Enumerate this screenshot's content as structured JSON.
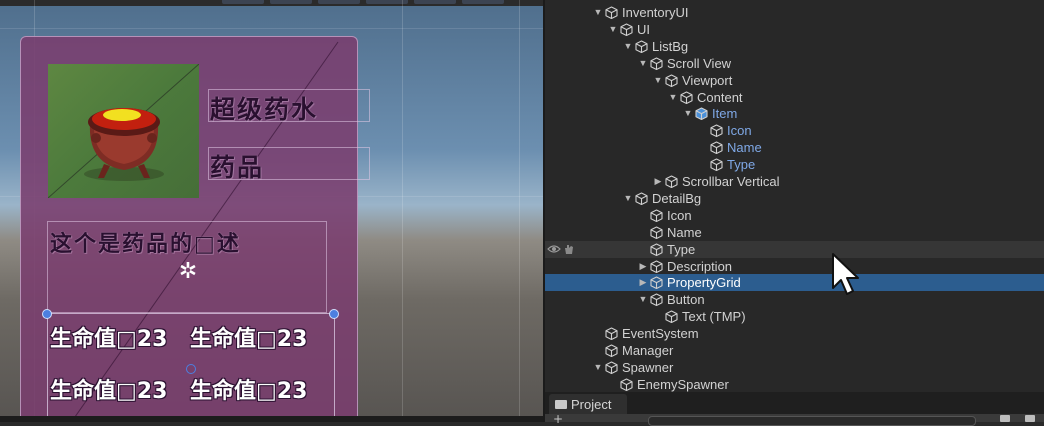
{
  "scene": {
    "detail_panel": {
      "name_text": "超级药水",
      "type_text": "药品",
      "description_text": "这个是药品的□述",
      "properties": [
        "生命值□23",
        "生命值□23",
        "生命值□23",
        "生命值□23"
      ]
    },
    "colors": {
      "panel": "#7a3e6e",
      "icon_bg": "#5a8441",
      "potion": "#f2e020"
    }
  },
  "hierarchy": {
    "rows": [
      {
        "label": "InventoryUI",
        "expanded": true
      },
      {
        "label": "UI",
        "expanded": true
      },
      {
        "label": "ListBg",
        "expanded": true
      },
      {
        "label": "Scroll View",
        "expanded": true
      },
      {
        "label": "Viewport",
        "expanded": true
      },
      {
        "label": "Content",
        "expanded": true
      },
      {
        "label": "Item",
        "expanded": true,
        "prefab": true
      },
      {
        "label": "Icon",
        "prefab": true
      },
      {
        "label": "Name",
        "prefab": true
      },
      {
        "label": "Type",
        "prefab": true
      },
      {
        "label": "Scrollbar Vertical",
        "expanded": false
      },
      {
        "label": "DetailBg",
        "expanded": true
      },
      {
        "label": "Icon"
      },
      {
        "label": "Name"
      },
      {
        "label": "Type",
        "hovered": true
      },
      {
        "label": "Description",
        "expanded": false
      },
      {
        "label": "PropertyGrid",
        "expanded": false,
        "selected": true
      },
      {
        "label": "Button",
        "expanded": true
      },
      {
        "label": "Text (TMP)"
      },
      {
        "label": "EventSystem"
      },
      {
        "label": "Manager"
      },
      {
        "label": "Spawner",
        "expanded": true
      },
      {
        "label": "EnemySpawner"
      }
    ],
    "colors": {
      "selected": "#2c5d8f",
      "prefab_text": "#7fa8e6"
    }
  },
  "project": {
    "tab_label": "Project",
    "add_label": "+"
  },
  "icons": {
    "expand": "triangle-down",
    "collapse": "triangle-right",
    "gameobject": "cube-icon",
    "visibility": "eye-icon",
    "pick": "hand-icon",
    "folder": "folder-icon"
  }
}
